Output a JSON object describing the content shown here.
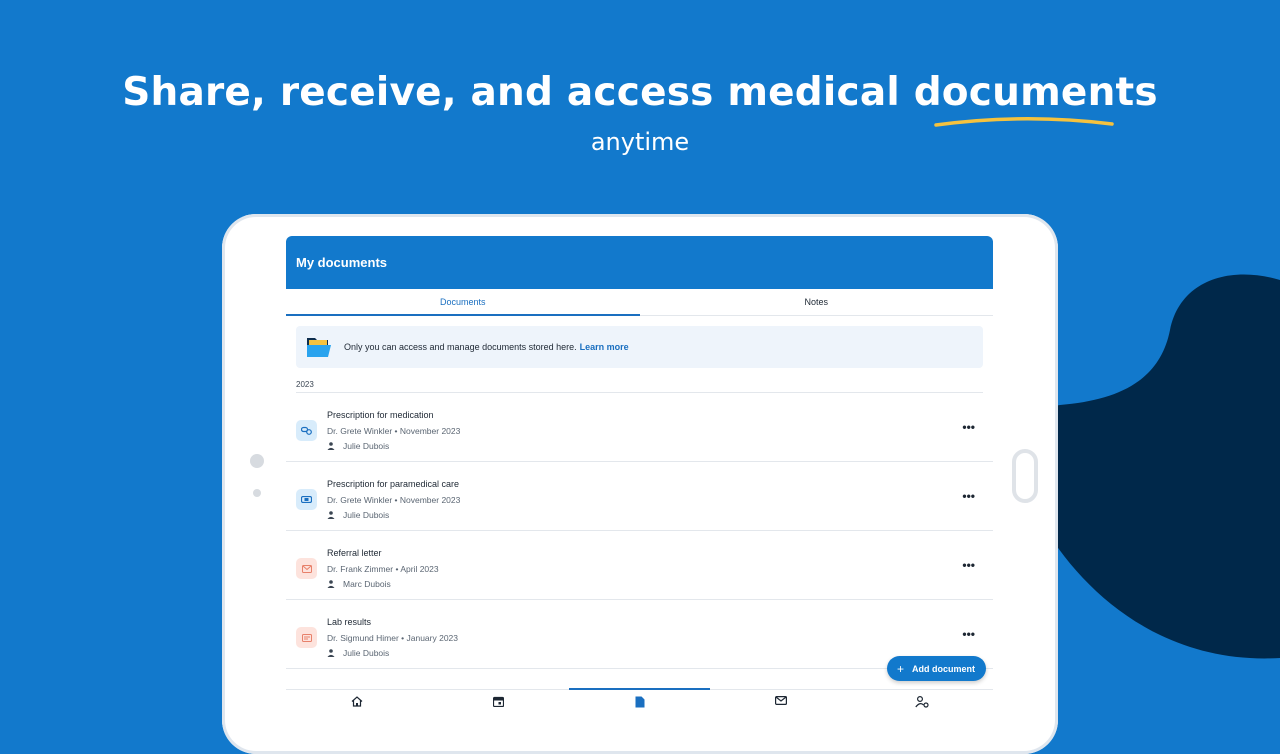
{
  "hero": {
    "headline_part1": "Share, receive, and access medical ",
    "headline_highlight": "documents",
    "subline": "anytime"
  },
  "colors": {
    "background": "#1279CC",
    "accent_underline": "#F5C23E",
    "blob": "#00284A",
    "primary": "#1a6fc0"
  },
  "app": {
    "title": "My documents",
    "tabs": [
      {
        "label": "Documents",
        "active": true
      },
      {
        "label": "Notes",
        "active": false
      }
    ],
    "banner": {
      "text": "Only you can access and manage documents stored here.",
      "link": "Learn more",
      "icon": "folder-icon"
    },
    "year": "2023",
    "documents": [
      {
        "title": "Prescription for medication",
        "meta": "Dr. Grete Winkler • November 2023",
        "patient": "Julie Dubois",
        "icon": "pills-icon"
      },
      {
        "title": "Prescription for paramedical care",
        "meta": "Dr. Grete Winkler • November 2023",
        "patient": "Julie Dubois",
        "icon": "bandage-icon"
      },
      {
        "title": "Referral letter",
        "meta": " Dr. Frank Zimmer • April 2023",
        "patient": "Marc Dubois",
        "icon": "letter-icon"
      },
      {
        "title": "Lab results",
        "meta": "Dr. Sigmund Himer • January 2023",
        "patient": "Julie Dubois",
        "icon": "lab-report-icon"
      }
    ],
    "more_label": "•••",
    "add_document": "Add document",
    "bottom_nav": [
      {
        "icon": "home-icon",
        "active": false
      },
      {
        "icon": "calendar-icon",
        "active": false
      },
      {
        "icon": "document-icon",
        "active": true
      },
      {
        "icon": "mail-icon",
        "active": false
      },
      {
        "icon": "account-settings-icon",
        "active": false
      }
    ]
  }
}
